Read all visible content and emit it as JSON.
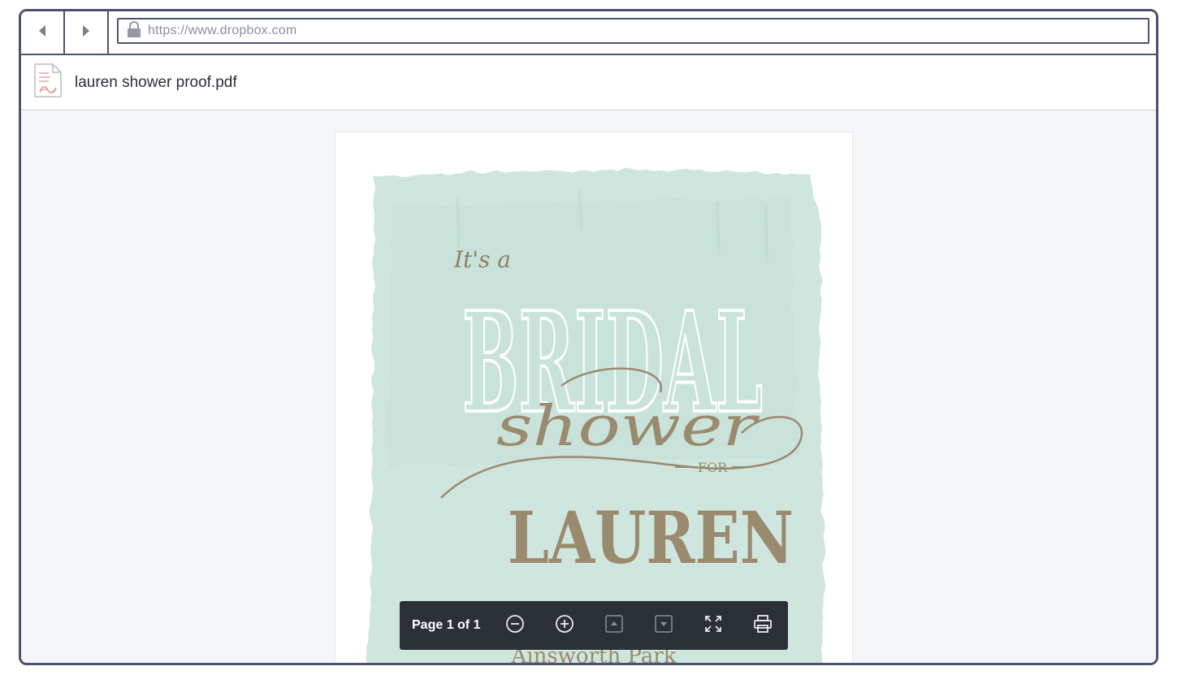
{
  "browser": {
    "url": "https://www.dropbox.com",
    "icons": {
      "back": "back-arrow-icon",
      "forward": "forward-arrow-icon",
      "lock": "lock-icon"
    }
  },
  "file": {
    "name": "lauren shower proof.pdf",
    "icon": "pdf-file-icon"
  },
  "pdf": {
    "script_line": "It's a",
    "headline": "BRIDAL",
    "script_word": "shower",
    "connector": "FOR",
    "honoree": "LAUREN",
    "location": "Ainsworth Park"
  },
  "viewer_toolbar": {
    "page_indicator": "Page 1 of 1",
    "buttons": [
      "zoom-out-icon",
      "zoom-in-icon",
      "previous-page-icon",
      "next-page-icon",
      "fullscreen-icon",
      "print-icon"
    ]
  },
  "colors": {
    "frame": "#4b5270",
    "watercolor": "#cfe6df",
    "accent_brown": "#9a8a6e",
    "toolbar_bg": "#2b2f36"
  }
}
